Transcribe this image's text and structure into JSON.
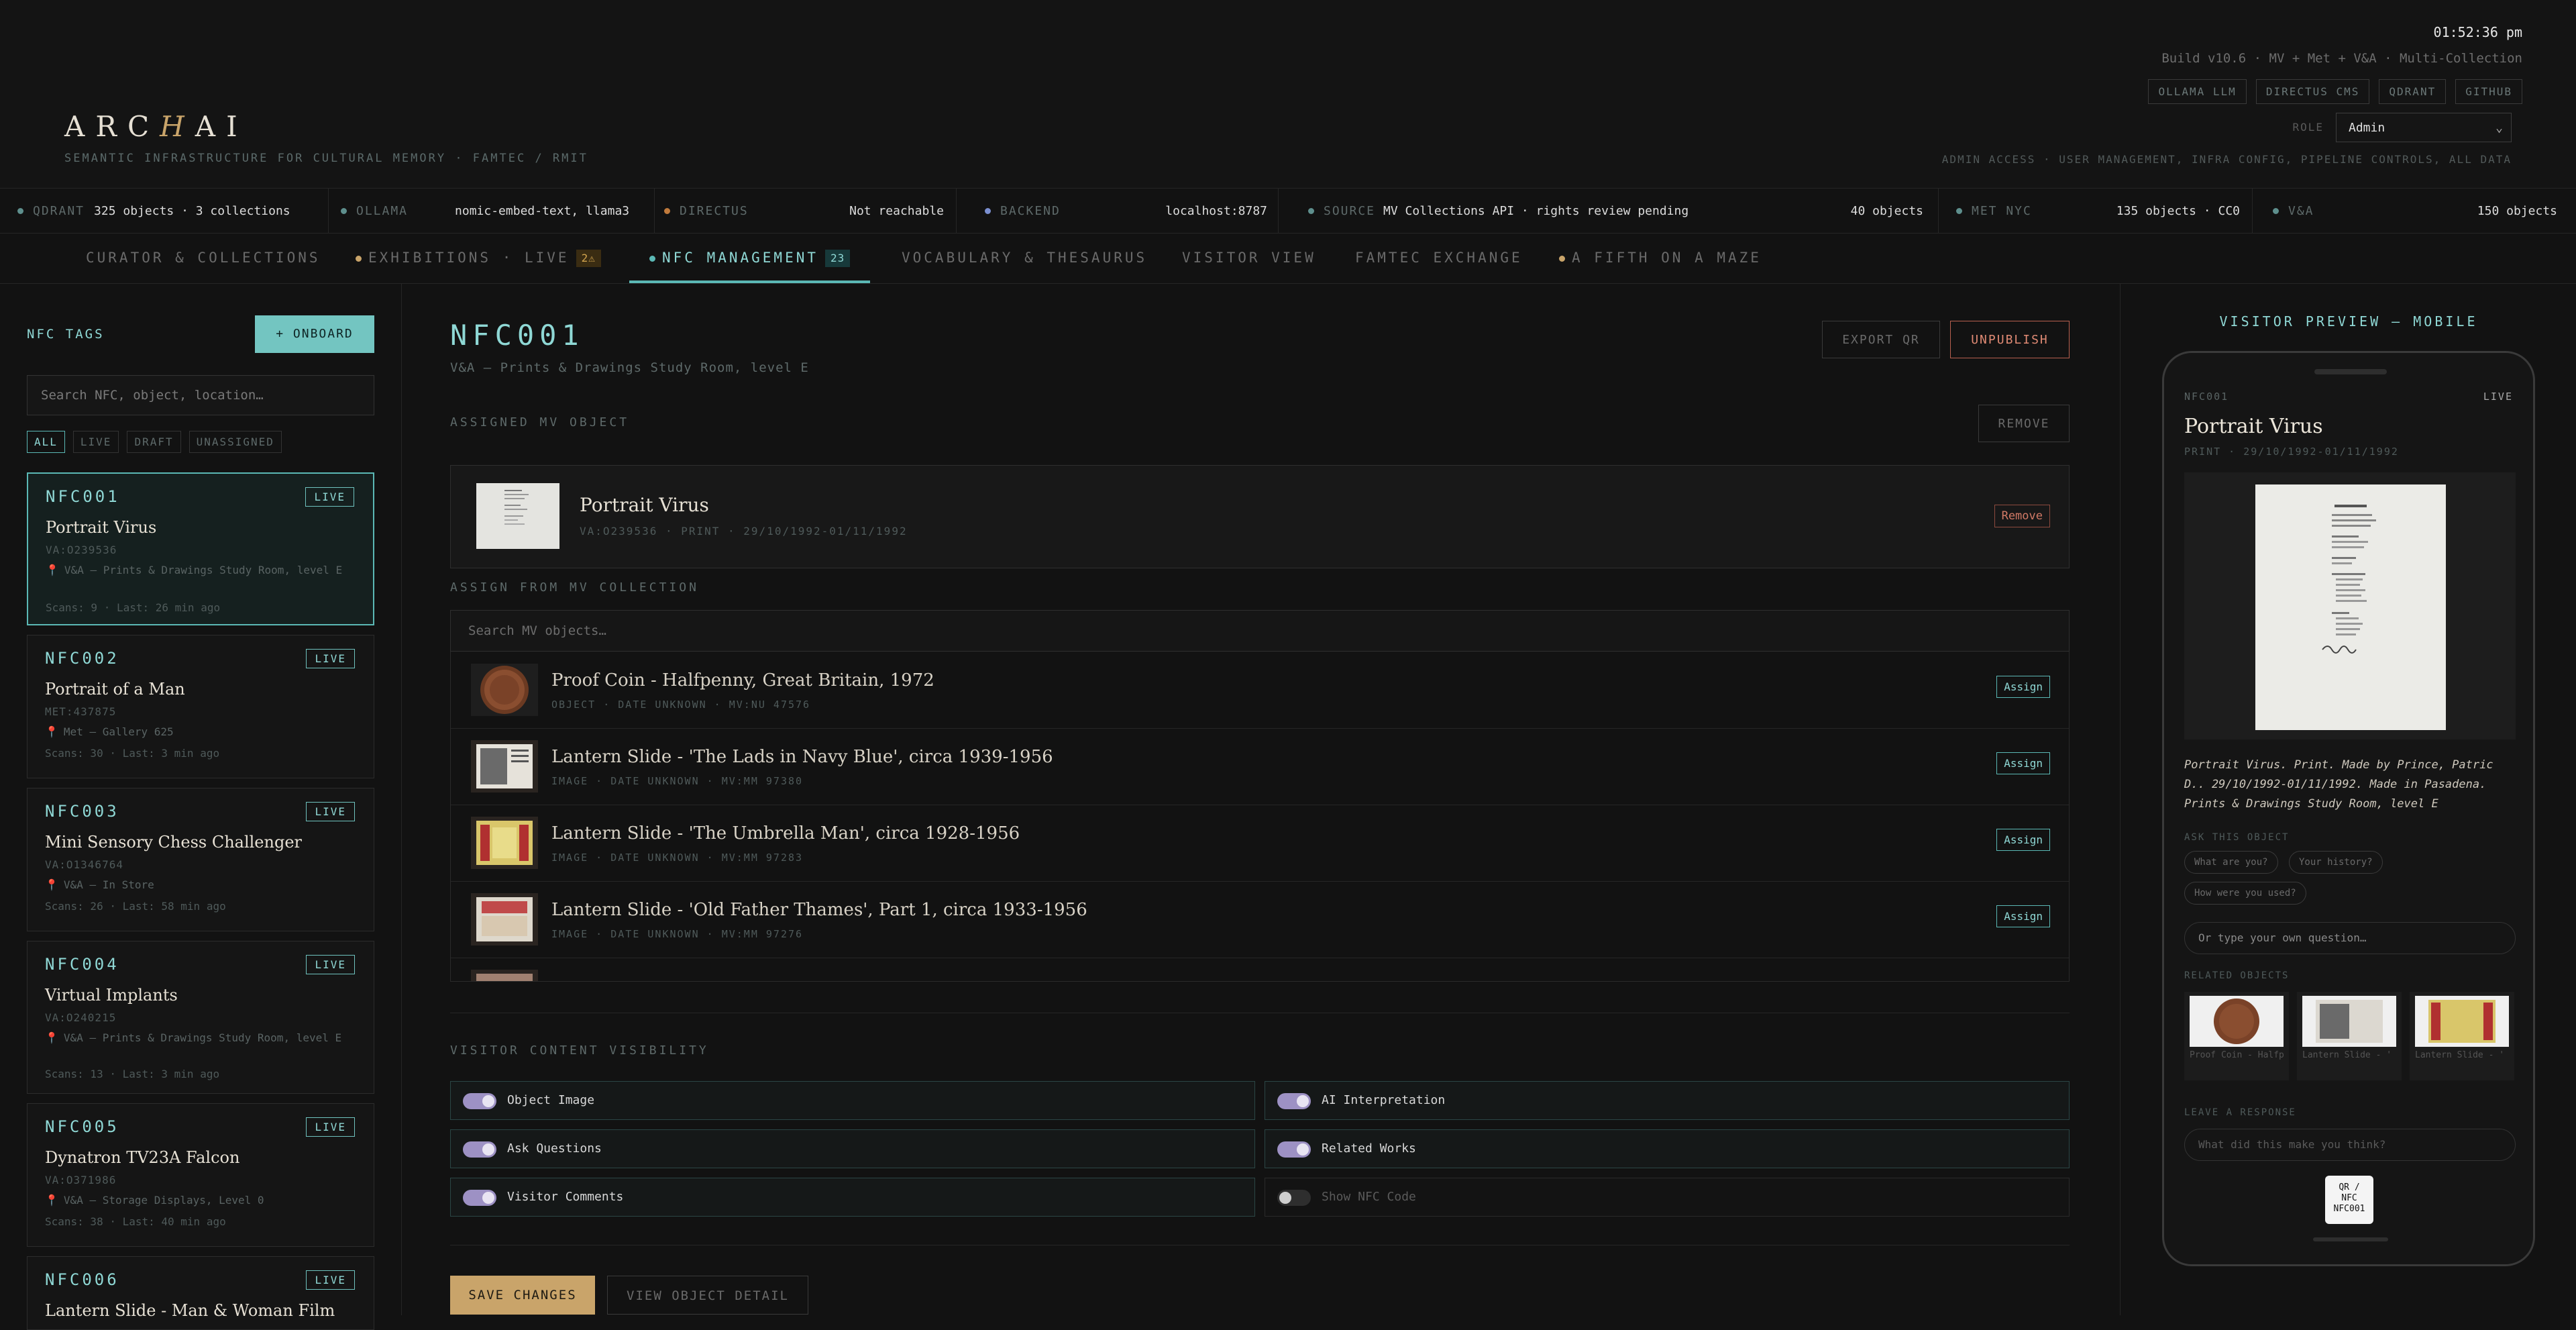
{
  "header": {
    "logo_pre": "ARC",
    "logo_hi": "H",
    "logo_post": "AI",
    "tagline": "SEMANTIC INFRASTRUCTURE FOR CULTURAL MEMORY · FAMTEC / RMIT",
    "clock": "01:52:36 pm",
    "build": "Build v10.6 · MV + Met + V&A · Multi-Collection",
    "services": [
      "OLLAMA LLM",
      "DIRECTUS CMS",
      "QDRANT",
      "GITHUB"
    ],
    "role_label": "ROLE",
    "role_value": "Admin",
    "admin_note": "ADMIN ACCESS · USER MANAGEMENT, INFRA CONFIG, PIPELINE CONTROLS, ALL DATA"
  },
  "status": {
    "qdrant": {
      "key": "QDRANT",
      "value": "325 objects · 3 collections",
      "color": "#5e8f8d"
    },
    "ollama": {
      "key": "OLLAMA",
      "value": "nomic-embed-text, llama3",
      "color": "#5e8f8d"
    },
    "directus": {
      "key": "DIRECTUS",
      "value": "Not reachable",
      "color": "#c07a3c"
    },
    "backend": {
      "key": "BACKEND",
      "value": "localhost:8787",
      "color": "#7b8fd0"
    },
    "source": {
      "key": "SOURCE",
      "value": "MV Collections API · rights review pending",
      "count": "40 objects",
      "color": "#5e8f8d"
    },
    "met": {
      "key": "MET NYC",
      "value": "135 objects · CC0",
      "color": "#5e8f8d"
    },
    "va": {
      "key": "V&A",
      "value": "150 objects",
      "color": "#5e8f8d"
    }
  },
  "tabs": [
    {
      "label": "CURATOR & COLLECTIONS"
    },
    {
      "label": "EXHIBITIONS · LIVE",
      "badge": "2⚠"
    },
    {
      "label": "NFC MANAGEMENT",
      "badge": "23"
    },
    {
      "label": "VOCABULARY & THESAURUS"
    },
    {
      "label": "VISITOR VIEW"
    },
    {
      "label": "FAMTEC EXCHANGE"
    },
    {
      "label": "A FIFTH ON A MAZE"
    }
  ],
  "sidebar": {
    "title": "NFC TAGS",
    "onboard": "+ ONBOARD",
    "search_placeholder": "Search NFC, object, location…",
    "filters": [
      "ALL",
      "LIVE",
      "DRAFT",
      "UNASSIGNED"
    ],
    "cards": [
      {
        "id": "NFC001",
        "badge": "LIVE",
        "title": "Portrait Virus",
        "acc": "VA:O239536",
        "loc": "V&A — Prints & Drawings Study Room, level E",
        "scans": "Scans: 9 · Last: 26 min ago"
      },
      {
        "id": "NFC002",
        "badge": "LIVE",
        "title": "Portrait of a Man",
        "acc": "MET:437875",
        "loc": "Met — Gallery 625",
        "scans": "Scans: 30 · Last: 3 min ago"
      },
      {
        "id": "NFC003",
        "badge": "LIVE",
        "title": "Mini Sensory Chess Challenger",
        "acc": "VA:O1346764",
        "loc": "V&A — In Store",
        "scans": "Scans: 26 · Last: 58 min ago"
      },
      {
        "id": "NFC004",
        "badge": "LIVE",
        "title": "Virtual Implants",
        "acc": "VA:O240215",
        "loc": "V&A — Prints & Drawings Study Room, level E",
        "scans": "Scans: 13 · Last: 3 min ago"
      },
      {
        "id": "NFC005",
        "badge": "LIVE",
        "title": "Dynatron TV23A Falcon",
        "acc": "VA:O371986",
        "loc": "V&A — Storage Displays, Level 0",
        "scans": "Scans: 38 · Last: 40 min ago"
      },
      {
        "id": "NFC006",
        "badge": "LIVE",
        "title": "Lantern Slide - Man & Woman Film"
      }
    ]
  },
  "main": {
    "id": "NFC001",
    "loc": "V&A — Prints & Drawings Study Room, level E",
    "export": "EXPORT QR",
    "unpublish": "UNPUBLISH",
    "assigned_label": "ASSIGNED MV OBJECT",
    "remove_top": "REMOVE",
    "assigned": {
      "title": "Portrait Virus",
      "meta": "VA:O239536 · PRINT · 29/10/1992-01/11/1992",
      "remove": "Remove"
    },
    "assign_label": "ASSIGN FROM MV COLLECTION",
    "mv_search_placeholder": "Search MV objects…",
    "mv_items": [
      {
        "title": "Proof Coin - Halfpenny, Great Britain, 1972",
        "meta": "OBJECT · DATE UNKNOWN · MV:NU 47576",
        "action": "Assign"
      },
      {
        "title": "Lantern Slide - 'The Lads in Navy Blue', circa 1939-1956",
        "meta": "IMAGE · DATE UNKNOWN · MV:MM 97380",
        "action": "Assign"
      },
      {
        "title": "Lantern Slide - 'The Umbrella Man', circa 1928-1956",
        "meta": "IMAGE · DATE UNKNOWN · MV:MM 97283",
        "action": "Assign"
      },
      {
        "title": "Lantern Slide - 'Old Father Thames', Part 1, circa 1933-1956",
        "meta": "IMAGE · DATE UNKNOWN · MV:MM 97276",
        "action": "Assign"
      }
    ],
    "visibility_label": "VISITOR CONTENT VISIBILITY",
    "toggles": [
      {
        "label": "Object Image",
        "on": true
      },
      {
        "label": "AI Interpretation",
        "on": true
      },
      {
        "label": "Ask Questions",
        "on": true
      },
      {
        "label": "Related Works",
        "on": true
      },
      {
        "label": "Visitor Comments",
        "on": true
      },
      {
        "label": "Show NFC Code",
        "on": false
      }
    ],
    "save": "SAVE CHANGES",
    "view": "VIEW OBJECT DETAIL"
  },
  "preview": {
    "title": "VISITOR PREVIEW — MOBILE",
    "id": "NFC001",
    "live": "LIVE",
    "obj_title": "Portrait Virus",
    "meta": "PRINT · 29/10/1992-01/11/1992",
    "desc": "Portrait Virus. Print. Made by Prince, Patric D.. 29/10/1992-01/11/1992. Made in Pasadena. Prints & Drawings Study Room, level E",
    "ask_label": "ASK THIS OBJECT",
    "chips": [
      "What are you?",
      "Your history?",
      "How were you used?"
    ],
    "input_placeholder": "Or type your own question…",
    "related_label": "RELATED OBJECTS",
    "related": [
      "Proof Coin - Halfp",
      "Lantern Slide - '",
      "Lantern Slide - '"
    ],
    "leave_label": "LEAVE A RESPONSE",
    "response_placeholder": "What did this make you think?",
    "qr_line1": "QR /",
    "qr_line2": "NFC",
    "qr_line3": "NFC001"
  }
}
